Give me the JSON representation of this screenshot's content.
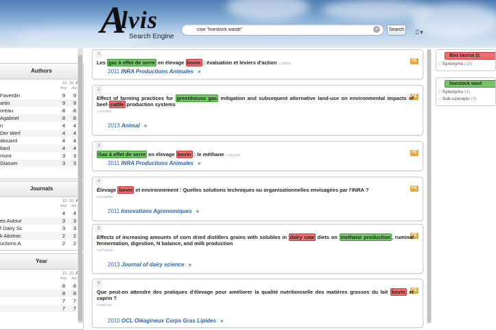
{
  "app": {
    "logo_letter": "A",
    "logo_word": "lvis",
    "logo_sub": "Search Engine"
  },
  "search": {
    "query": "cow \"livestock waste\"",
    "button": "Search"
  },
  "facets": {
    "topn_options": [
      "10",
      "20",
      "All"
    ],
    "col_freq": "freq.",
    "col_doc": "doc.",
    "authors": {
      "title": "Authors",
      "rows": [
        [
          "Faverdin",
          "9",
          "9"
        ],
        [
          "artin",
          "9",
          "9"
        ],
        [
          "oreau",
          "8",
          "8"
        ],
        [
          "Agabriel",
          "8",
          "8"
        ],
        [
          "n",
          "4",
          "4"
        ],
        [
          "Der Werf",
          "4",
          "4"
        ],
        [
          "idouard",
          "4",
          "4"
        ],
        [
          "liard",
          "4",
          "4"
        ],
        [
          "mont",
          "3",
          "3"
        ],
        [
          "Glasser",
          "3",
          "3"
        ]
      ]
    },
    "journals": {
      "title": "Journals",
      "rows": [
        [
          "",
          "4",
          "4"
        ],
        [
          "es Autour",
          "3",
          "3"
        ],
        [
          "f Dairy Sc",
          "3",
          "3"
        ],
        [
          "k Abstrac",
          "2",
          "2"
        ],
        [
          "uctions A",
          "2",
          "2"
        ]
      ]
    },
    "year": {
      "title": "Year",
      "rows": [
        [
          "",
          "8",
          "8"
        ],
        [
          "",
          "8",
          "8"
        ],
        [
          "",
          "7",
          "7"
        ],
        [
          "",
          "7",
          "7"
        ]
      ]
    }
  },
  "results": [
    {
      "num": "1",
      "fe": "FE",
      "score": "1.338318",
      "year": "2011",
      "journal": "INRA Productions Animales",
      "t": [
        [
          "Les ",
          ""
        ],
        [
          "gaz à effet de serre",
          "g"
        ],
        [
          " en élevage ",
          ""
        ],
        [
          "bovin",
          "r"
        ],
        [
          " : évaluation et leviers d'action",
          ""
        ]
      ]
    },
    {
      "num": "2",
      "fe": "FE",
      "score": "1.3041983",
      "year": "2013",
      "journal": "Animal",
      "t": [
        [
          "Effect of farming practices for ",
          ""
        ],
        [
          "greenhouse gas",
          "g"
        ],
        [
          " mitigation and subsequent alternative land-use on environmental impacts of beef-",
          ""
        ],
        [
          "cattle",
          "r"
        ],
        [
          " production systems",
          ""
        ]
      ]
    },
    {
      "num": "3",
      "fe": "FE",
      "score": "0.8497288",
      "year": "2011",
      "journal": "INRA Productions Animales",
      "t": [
        [
          "Gaz à effet de serre",
          "g"
        ],
        [
          " en élevage ",
          ""
        ],
        [
          "bovin",
          "r"
        ],
        [
          " : le méthane",
          ""
        ]
      ]
    },
    {
      "num": "4",
      "fe": "FE",
      "score": "0.81488855",
      "year": "2011",
      "journal": "Innovations Agronomiques",
      "t": [
        [
          "Élevage ",
          ""
        ],
        [
          "bovin",
          "r"
        ],
        [
          " et environnement : Quelles solutions techniques ou organisationnelles envisagées par l'INRA ?",
          ""
        ]
      ]
    },
    {
      "num": "5",
      "fe": "FE",
      "score": "0.67702436",
      "year": "2013",
      "journal": "Journal of dairy science",
      "t": [
        [
          "Effects of increasing amounts of corn dried distillers grains with solubles in ",
          ""
        ],
        [
          "dairy cow",
          "r"
        ],
        [
          " diets on ",
          ""
        ],
        [
          "methane production",
          "g"
        ],
        [
          ", ruminal fermentation, digestion, N balance, and milk production",
          ""
        ]
      ]
    },
    {
      "num": "6",
      "fe": "FE",
      "score": "0.5698726",
      "year": "2010",
      "journal": "OCL Oléagineux Corps Gras Lipides",
      "t": [
        [
          "Que peut-on attendre des pratiques d'élevage pour améliorer la qualité nutritionnelle des matières grasses du lait ",
          ""
        ],
        [
          "bovin",
          "r"
        ],
        [
          " et caprin ?",
          ""
        ]
      ]
    }
  ],
  "concepts": [
    {
      "label": "Bos taurus (c",
      "color": "red",
      "items": [
        [
          "Synonyms",
          "(18)"
        ]
      ]
    },
    {
      "label": "livestock wast",
      "color": "green",
      "items": [
        [
          "Synonyms",
          "(4)"
        ],
        [
          "Sub-concepts",
          "(3)"
        ]
      ]
    }
  ]
}
